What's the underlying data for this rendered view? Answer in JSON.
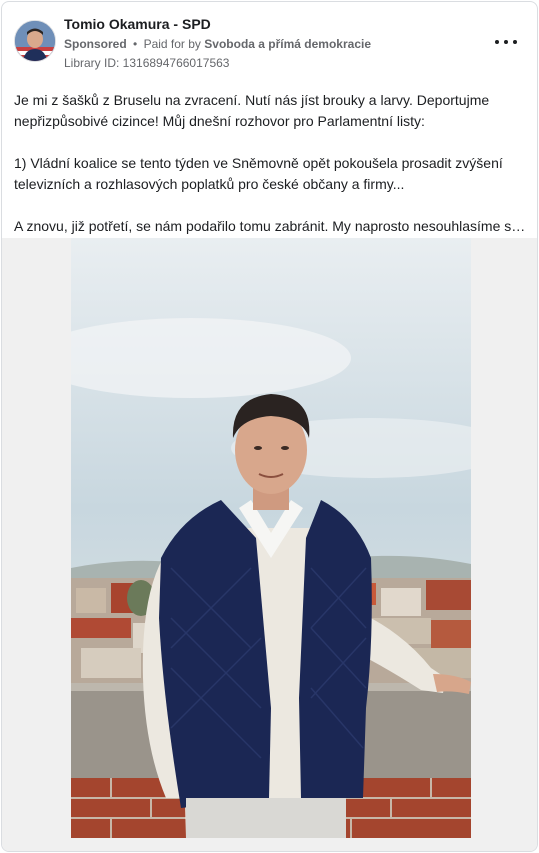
{
  "ad": {
    "page_name": "Tomio Okamura - SPD",
    "sponsored_label": "Sponsored",
    "separator": "•",
    "paid_for_label": "Paid for by",
    "payer": "Svoboda a přímá demokracie",
    "library_id": "Library ID: 1316894766017563",
    "more_icon": "more-horizontal-icon"
  },
  "body": {
    "paragraphs": [
      "Je mi z šašků z Bruselu na zvracení. Nutí nás jíst brouky a larvy. Deportujme nepřizpůsobivé cizince! Můj dnešní rozhovor pro Parlamentní listy:",
      "1) Vládní koalice se tento týden ve Sněmovně opět pokoušela prosadit zvýšení televizních a rozhlasových poplatků pro české občany a firmy...",
      "A znovu, již potřetí, se nám podařilo tomu zabránit. My naprosto nesouhlasíme se..."
    ]
  },
  "colors": {
    "text_primary": "#1c1e21",
    "text_secondary": "#65676b",
    "border": "#dadde1",
    "media_background": "#f0f0f0"
  }
}
